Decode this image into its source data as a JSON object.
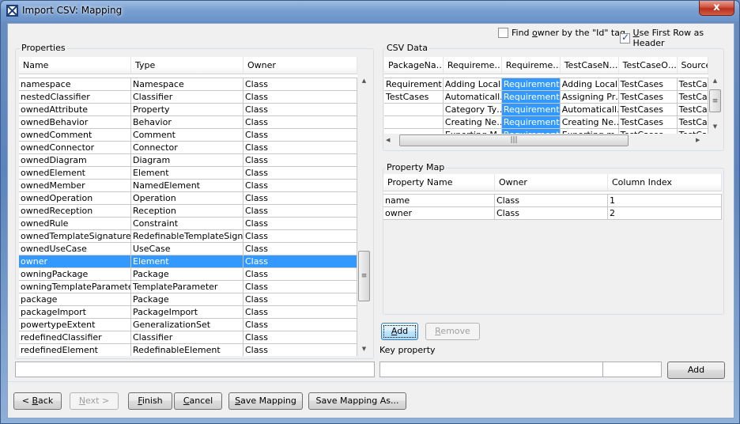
{
  "window": {
    "title": "Import CSV: Mapping",
    "close_label": "x"
  },
  "options": {
    "find_owner": {
      "label_pre": "Find ",
      "label_u": "o",
      "label_post": "wner by the \"Id\" tag",
      "checked": false
    },
    "use_first_row": {
      "label_pre": "",
      "label_u": "U",
      "label_post": "se First Row as Header",
      "checked": true
    }
  },
  "properties": {
    "group_label": "Properties",
    "columns": [
      "Name",
      "Type",
      "Owner"
    ],
    "rows": [
      [
        "namespace",
        "Namespace",
        "Class"
      ],
      [
        "nestedClassifier",
        "Classifier",
        "Class"
      ],
      [
        "ownedAttribute",
        "Property",
        "Class"
      ],
      [
        "ownedBehavior",
        "Behavior",
        "Class"
      ],
      [
        "ownedComment",
        "Comment",
        "Class"
      ],
      [
        "ownedConnector",
        "Connector",
        "Class"
      ],
      [
        "ownedDiagram",
        "Diagram",
        "Class"
      ],
      [
        "ownedElement",
        "Element",
        "Class"
      ],
      [
        "ownedMember",
        "NamedElement",
        "Class"
      ],
      [
        "ownedOperation",
        "Operation",
        "Class"
      ],
      [
        "ownedReception",
        "Reception",
        "Class"
      ],
      [
        "ownedRule",
        "Constraint",
        "Class"
      ],
      [
        "ownedTemplateSignature",
        "RedefinableTemplateSigna…",
        "Class"
      ],
      [
        "ownedUseCase",
        "UseCase",
        "Class"
      ],
      [
        "owner",
        "Element",
        "Class"
      ],
      [
        "owningPackage",
        "Package",
        "Class"
      ],
      [
        "owningTemplateParameter",
        "TemplateParameter",
        "Class"
      ],
      [
        "package",
        "Package",
        "Class"
      ],
      [
        "packageImport",
        "PackageImport",
        "Class"
      ],
      [
        "powertypeExtent",
        "GeneralizationSet",
        "Class"
      ],
      [
        "redefinedClassifier",
        "Classifier",
        "Class"
      ],
      [
        "redefinedElement",
        "RedefinableElement",
        "Class"
      ]
    ],
    "selected_index": 14,
    "filter_value": ""
  },
  "csv_data": {
    "group_label": "CSV Data",
    "columns": [
      "PackageNa…",
      "Requireme…",
      "Requireme…",
      "TestCaseN…",
      "TestCaseO…",
      "Source"
    ],
    "rows": [
      [
        "Requirement",
        "Adding Local…",
        "Requirement",
        "Adding Local…",
        "TestCases",
        "TestCa"
      ],
      [
        "TestCases",
        "Automaticall…",
        "Requirement",
        "Assigning Pr…",
        "TestCases",
        "TestCa"
      ],
      [
        "",
        "Category Ty…",
        "Requirement",
        "Automaticall…",
        "TestCases",
        "TestCa"
      ],
      [
        "",
        "Creating Ne…",
        "Requirement",
        "Creating Ne…",
        "TestCases",
        "TestCa"
      ],
      [
        "",
        "Exporting M…",
        "Requirement",
        "Exporting m…",
        "TestCases",
        "TestCa"
      ]
    ],
    "selected_column": 2
  },
  "property_map": {
    "group_label": "Property Map",
    "columns": [
      "Property Name",
      "Owner",
      "Column Index"
    ],
    "rows": [
      [
        "name",
        "Class",
        "1"
      ],
      [
        "owner",
        "Class",
        "2"
      ]
    ],
    "add_label_u": "A",
    "add_label_rest": "dd",
    "remove_label_u": "R",
    "remove_label_rest": "emove"
  },
  "key_property": {
    "label": "Key property",
    "value1": "",
    "value2": "",
    "add_label": "Add"
  },
  "footer": {
    "back": {
      "pre": "< ",
      "u": "B",
      "post": "ack"
    },
    "next": {
      "pre": "",
      "u": "N",
      "post": "ext >"
    },
    "finish": {
      "pre": "",
      "u": "F",
      "post": "inish"
    },
    "cancel": {
      "pre": "",
      "u": "C",
      "post": "ancel"
    },
    "save_mapping": {
      "pre": "",
      "u": "S",
      "post": "ave Mapping"
    },
    "save_mapping_as": {
      "pre": "",
      "u": "",
      "post": "Save Mapping As..."
    }
  }
}
